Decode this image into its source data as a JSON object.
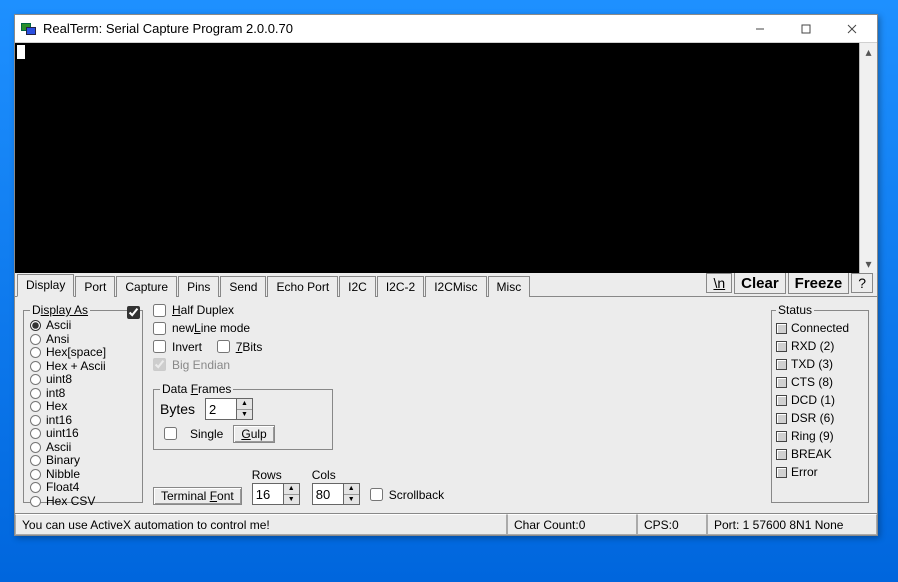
{
  "title": "RealTerm: Serial Capture Program 2.0.0.70",
  "tabs": [
    "Display",
    "Port",
    "Capture",
    "Pins",
    "Send",
    "Echo Port",
    "I2C",
    "I2C-2",
    "I2CMisc",
    "Misc"
  ],
  "tab_buttons": {
    "newline": "\\n",
    "clear": "Clear",
    "freeze": "Freeze",
    "help": "?"
  },
  "display_as": {
    "legend_pre": "D",
    "legend_ul": "isplay As",
    "items": [
      "Ascii",
      "Ansi",
      "Hex[space]",
      "Hex + Ascii",
      "uint8",
      "int8",
      "Hex",
      "int16",
      "uint16",
      "Ascii",
      "Binary",
      "Nibble",
      "Float4",
      "Hex CSV"
    ],
    "selected_index": 0
  },
  "mode_checks": {
    "half_duplex": "Half Duplex",
    "newline_mode": "newLine mode",
    "invert": "Invert",
    "seven_bits": "7Bits",
    "big_endian": "Big Endian"
  },
  "data_frames": {
    "legend": "Data Frames",
    "bytes_label": "Bytes",
    "bytes_value": "2",
    "single_label": "Single",
    "gulp_label": "Gulp"
  },
  "term_font_btn": "Terminal Font",
  "rows_label": "Rows",
  "rows_value": "16",
  "cols_label": "Cols",
  "cols_value": "80",
  "scrollback_label": "Scrollback",
  "status": {
    "legend": "Status",
    "items": [
      "Connected",
      "RXD (2)",
      "TXD (3)",
      "CTS (8)",
      "DCD (1)",
      "DSR (6)",
      "Ring (9)",
      "BREAK",
      "Error"
    ]
  },
  "statusbar": {
    "msg": "You can use ActiveX automation to control me!",
    "char_count": "Char Count:0",
    "cps": "CPS:0",
    "port": "Port: 1 57600 8N1 None"
  }
}
